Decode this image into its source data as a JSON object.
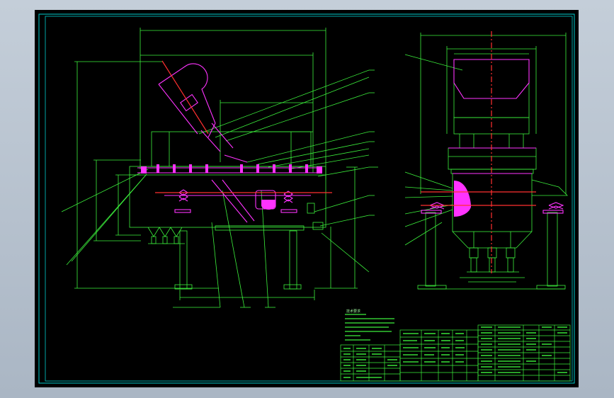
{
  "drawing": {
    "title_block": {
      "note_heading": "技术要求"
    },
    "colors": {
      "sheet_background": "#000000",
      "outer_border": "#00cccc",
      "geometry": "#3cf03c",
      "equipment": "#ff33ff",
      "center_line": "#ff3030",
      "body_fill": "#ff33ff"
    },
    "views": [
      "front-view",
      "side-view"
    ],
    "icons": [
      "drawing-sheet",
      "title-block-table",
      "parts-list-table"
    ]
  }
}
